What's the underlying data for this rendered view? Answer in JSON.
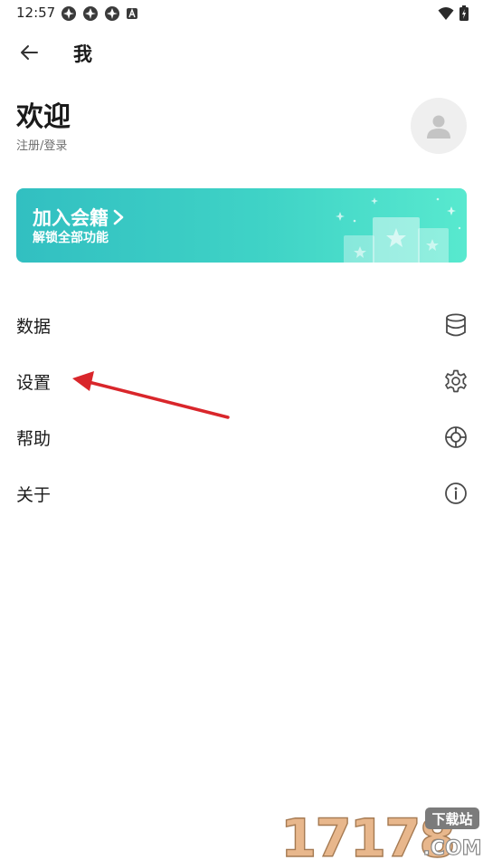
{
  "status_bar": {
    "time": "12:57"
  },
  "header": {
    "title": "我"
  },
  "profile": {
    "welcome": "欢迎",
    "login": "注册/登录"
  },
  "banner": {
    "title": "加入会籍",
    "subtitle": "解锁全部功能"
  },
  "menu": [
    {
      "label": "数据",
      "icon": "database-icon"
    },
    {
      "label": "设置",
      "icon": "gear-icon"
    },
    {
      "label": "帮助",
      "icon": "lifebuoy-icon"
    },
    {
      "label": "关于",
      "icon": "info-icon"
    }
  ],
  "watermark": {
    "number": "17178",
    "badge": "下载站",
    "domain": ".COM"
  },
  "colors": {
    "banner_start": "#32bfc1",
    "banner_end": "#58e9cf",
    "annotation_arrow": "#d9262b"
  }
}
